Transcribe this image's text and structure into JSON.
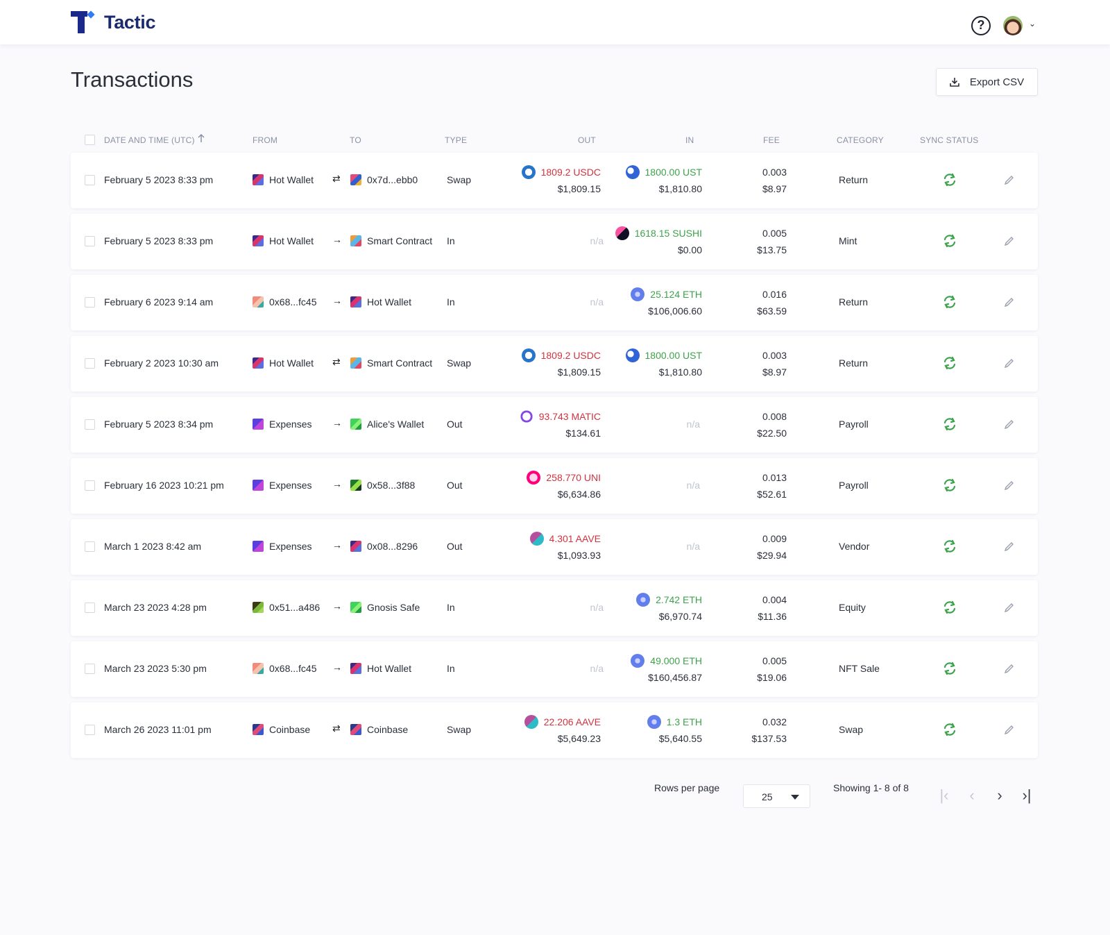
{
  "app": {
    "name": "Tactic"
  },
  "header": {
    "help_symbol": "?",
    "avatar_caret": "⌄"
  },
  "page": {
    "title": "Transactions",
    "export_label": "Export CSV"
  },
  "table": {
    "columns": {
      "date": "DATE AND TIME (UTC)",
      "from": "FROM",
      "to": "TO",
      "type": "TYPE",
      "out": "OUT",
      "in": "IN",
      "fee": "FEE",
      "category": "CATEGORY",
      "sync": "SYNC STATUS"
    },
    "rows": [
      {
        "date": "February 5 2023 8:33 pm",
        "from": "Hot Wallet",
        "from_icon": "hot-wallet",
        "arrow": "⇄",
        "to": "0x7d...ebb0",
        "to_icon": "addr-a",
        "type": "Swap",
        "out_amount": "1809.2 USDC",
        "out_usd": "$1,809.15",
        "out_token": "usdc",
        "in_amount": "1800.00 UST",
        "in_usd": "$1,810.80",
        "in_token": "ust",
        "fee": "0.003",
        "fee_usd": "$8.97",
        "category": "Return"
      },
      {
        "date": "February 5 2023 8:33 pm",
        "from": "Hot Wallet",
        "from_icon": "hot-wallet",
        "arrow": "→",
        "to": "Smart Contract",
        "to_icon": "contract",
        "type": "In",
        "out_amount": "n/a",
        "out_usd": "",
        "out_token": "",
        "in_amount": "1618.15 SUSHI",
        "in_usd": "$0.00",
        "in_token": "sushi",
        "fee": "0.005",
        "fee_usd": "$13.75",
        "category": "Mint"
      },
      {
        "date": "February 6 2023 9:14 am",
        "from": "0x68...fc45",
        "from_icon": "addr-b",
        "arrow": "→",
        "to": "Hot Wallet",
        "to_icon": "hot-wallet",
        "type": "In",
        "out_amount": "n/a",
        "out_usd": "",
        "out_token": "",
        "in_amount": "25.124 ETH",
        "in_usd": "$106,006.60",
        "in_token": "eth",
        "fee": "0.016",
        "fee_usd": "$63.59",
        "category": "Return"
      },
      {
        "date": "February 2 2023 10:30 am",
        "from": "Hot Wallet",
        "from_icon": "hot-wallet",
        "arrow": "⇄",
        "to": "Smart Contract",
        "to_icon": "contract",
        "type": "Swap",
        "out_amount": "1809.2 USDC",
        "out_usd": "$1,809.15",
        "out_token": "usdc",
        "in_amount": "1800.00 UST",
        "in_usd": "$1,810.80",
        "in_token": "ust",
        "fee": "0.003",
        "fee_usd": "$8.97",
        "category": "Return"
      },
      {
        "date": "February 5 2023 8:34 pm",
        "from": "Expenses",
        "from_icon": "expenses",
        "arrow": "→",
        "to": "Alice's Wallet",
        "to_icon": "alice",
        "type": "Out",
        "out_amount": "93.743 MATIC",
        "out_usd": "$134.61",
        "out_token": "matic",
        "in_amount": "n/a",
        "in_usd": "",
        "in_token": "",
        "fee": "0.008",
        "fee_usd": "$22.50",
        "category": "Payroll"
      },
      {
        "date": "February 16 2023 10:21 pm",
        "from": "Expenses",
        "from_icon": "expenses",
        "arrow": "→",
        "to": "0x58...3f88",
        "to_icon": "addr-c",
        "type": "Out",
        "out_amount": "258.770 UNI",
        "out_usd": "$6,634.86",
        "out_token": "uni",
        "in_amount": "n/a",
        "in_usd": "",
        "in_token": "",
        "fee": "0.013",
        "fee_usd": "$52.61",
        "category": "Payroll"
      },
      {
        "date": "March 1 2023 8:42 am",
        "from": "Expenses",
        "from_icon": "expenses",
        "arrow": "→",
        "to": "0x08...8296",
        "to_icon": "hot-wallet",
        "type": "Out",
        "out_amount": "4.301 AAVE",
        "out_usd": "$1,093.93",
        "out_token": "aave",
        "in_amount": "n/a",
        "in_usd": "",
        "in_token": "",
        "fee": "0.009",
        "fee_usd": "$29.94",
        "category": "Vendor"
      },
      {
        "date": "March 23 2023 4:28 pm",
        "from": "0x51...a486",
        "from_icon": "addr-d",
        "arrow": "→",
        "to": "Gnosis Safe",
        "to_icon": "alice",
        "type": "In",
        "out_amount": "n/a",
        "out_usd": "",
        "out_token": "",
        "in_amount": "2.742 ETH",
        "in_usd": "$6,970.74",
        "in_token": "eth",
        "fee": "0.004",
        "fee_usd": "$11.36",
        "category": "Equity"
      },
      {
        "date": "March 23 2023 5:30 pm",
        "from": "0x68...fc45",
        "from_icon": "addr-b",
        "arrow": "→",
        "to": "Hot Wallet",
        "to_icon": "hot-wallet",
        "type": "In",
        "out_amount": "n/a",
        "out_usd": "",
        "out_token": "",
        "in_amount": "49.000 ETH",
        "in_usd": "$160,456.87",
        "in_token": "eth",
        "fee": "0.005",
        "fee_usd": "$19.06",
        "category": "NFT Sale"
      },
      {
        "date": "March 26 2023 11:01 pm",
        "from": "Coinbase",
        "from_icon": "coinbase",
        "arrow": "⇄",
        "to": "Coinbase",
        "to_icon": "coinbase",
        "type": "Swap",
        "out_amount": "22.206 AAVE",
        "out_usd": "$5,649.23",
        "out_token": "aave",
        "in_amount": "1.3 ETH",
        "in_usd": "$5,640.55",
        "in_token": "eth",
        "fee": "0.032",
        "fee_usd": "$137.53",
        "category": "Swap"
      }
    ]
  },
  "pagination": {
    "rows_per_page_label": "Rows per page",
    "rows_per_page_value": "25",
    "showing": "Showing 1- 8 of 8",
    "first": "|‹",
    "prev": "‹",
    "next": "›",
    "last": "›|"
  },
  "colors": {
    "brand": "#1b2a8a",
    "accent": "#2f7df6",
    "out": "#d2333d",
    "in": "#3da34a",
    "sync": "#3da34a"
  }
}
